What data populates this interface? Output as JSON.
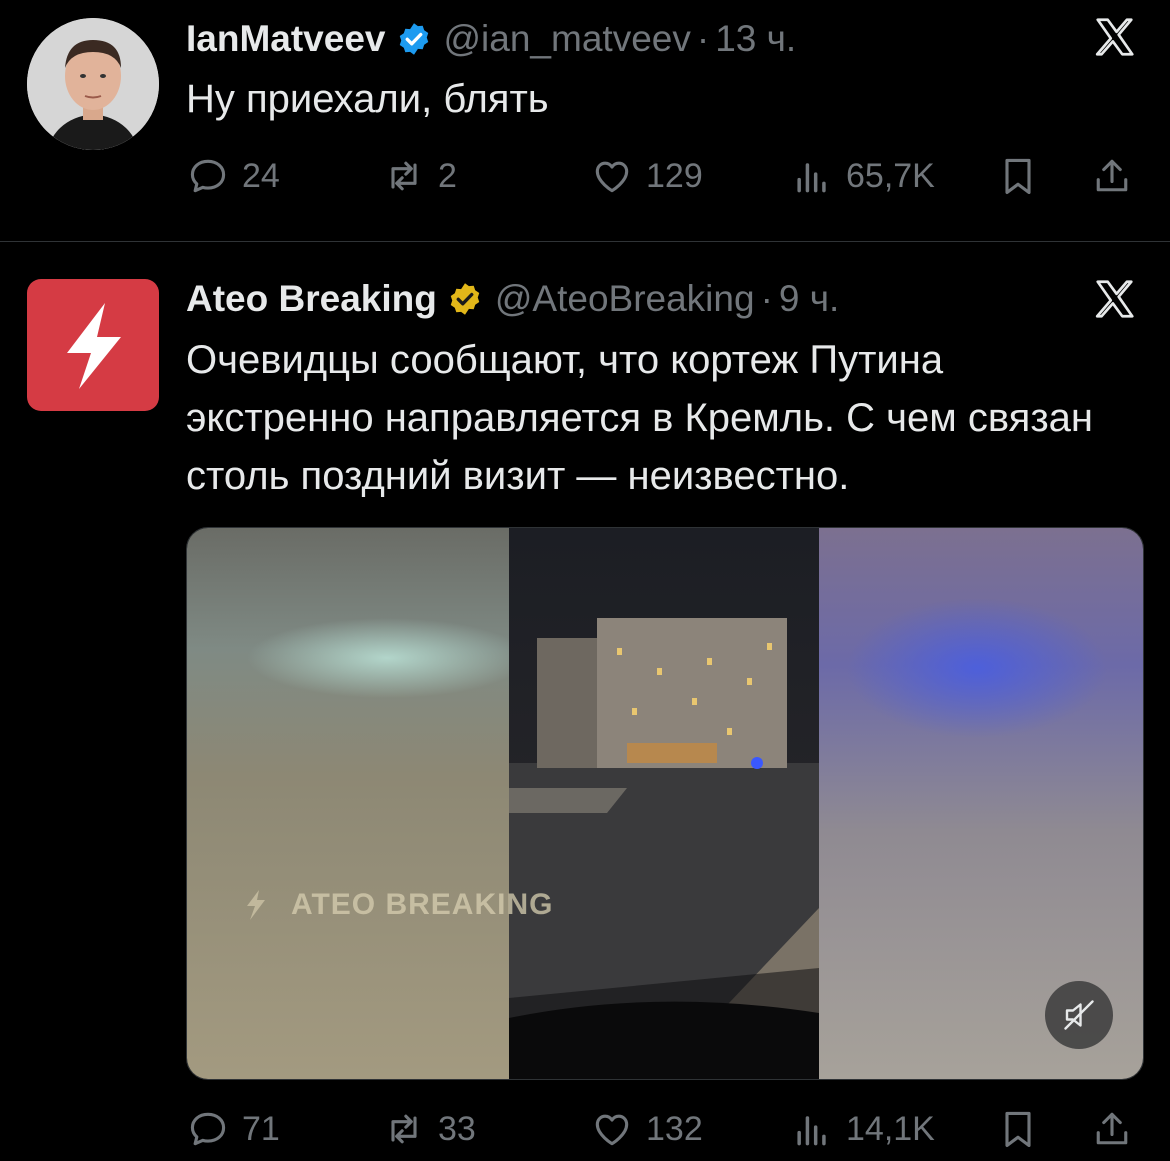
{
  "tweet1": {
    "display_name": "IanMatveev",
    "handle": "@ian_matveev",
    "dot": "·",
    "time": "13 ч.",
    "text": "Ну приехали, блять",
    "replies": "24",
    "retweets": "2",
    "likes": "129",
    "views": "65,7K"
  },
  "tweet2": {
    "display_name": "Ateo Breaking",
    "handle": "@AteoBreaking",
    "dot": "·",
    "time": "9 ч.",
    "text": "Очевидцы сообщают, что кортеж Путина экстренно направляется в Кремль. С чем связан столь поздний визит — неизвестно.",
    "watermark": "ATEO BREAKING",
    "replies": "71",
    "retweets": "33",
    "likes": "132",
    "views": "14,1K"
  },
  "colors": {
    "background": "#000000",
    "text": "#e7e9ea",
    "muted": "#71767b",
    "verified_blue": "#1d9bf0",
    "verified_gold": "#e2b719",
    "ateo_red": "#d53b44"
  },
  "icons": [
    "x-logo-icon",
    "verified-badge-icon",
    "reply-icon",
    "retweet-icon",
    "like-icon",
    "views-icon",
    "bookmark-icon",
    "share-icon",
    "lightning-icon",
    "mute-icon"
  ]
}
